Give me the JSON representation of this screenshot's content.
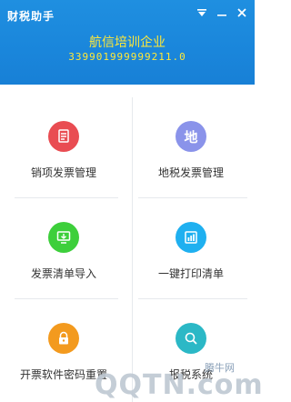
{
  "app": {
    "title": "财税助手",
    "company_name": "航信培训企业",
    "tax_id": "339901999999211.0"
  },
  "window": {
    "menu_icon": "menu-down-icon",
    "minimize_icon": "minimize-icon",
    "close_icon": "close-icon"
  },
  "tiles": [
    {
      "label": "销项发票管理",
      "icon": "invoice-doc-icon",
      "color": "#e94c52"
    },
    {
      "label": "地税发票管理",
      "icon": "local-tax-icon",
      "glyph": "地",
      "color": "#8a93ea"
    },
    {
      "label": "发票清单导入",
      "icon": "import-icon",
      "color": "#3dcf3b"
    },
    {
      "label": "一键打印清单",
      "icon": "print-list-icon",
      "color": "#1fb0f0"
    },
    {
      "label": "开票软件密码重置",
      "icon": "lock-icon",
      "color": "#f39a1e"
    },
    {
      "label": "报税系统",
      "icon": "search-icon",
      "color": "#2bb8c6"
    }
  ],
  "watermark": {
    "site": "腾牛网",
    "brand": "QQTN.com"
  },
  "colors": {
    "header_bg": "#1a86db",
    "header_text": "#ffe838"
  }
}
